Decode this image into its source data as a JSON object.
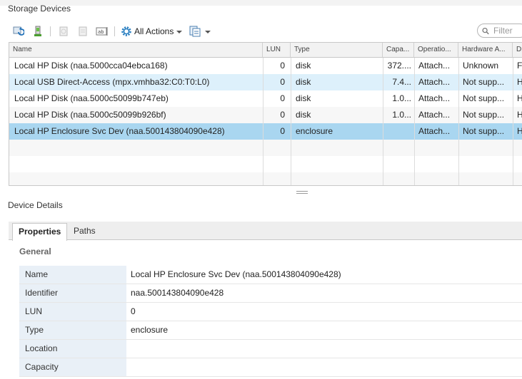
{
  "section": {
    "storage_title": "Storage Devices",
    "details_title": "Device Details"
  },
  "toolbar": {
    "all_actions_label": "All Actions",
    "filter_placeholder": "Filter"
  },
  "grid": {
    "columns": [
      "Name",
      "LUN",
      "Type",
      "Capa...",
      "Operatio...",
      "Hardware A...",
      "Dr"
    ],
    "rows": [
      {
        "name": "Local HP Disk (naa.5000cca04ebca168)",
        "lun": "0",
        "type": "disk",
        "capacity": "372....",
        "operational": "Attach...",
        "hardware": "Unknown",
        "drive": "F"
      },
      {
        "name": "Local USB Direct-Access (mpx.vmhba32:C0:T0:L0)",
        "lun": "0",
        "type": "disk",
        "capacity": "7.4...",
        "operational": "Attach...",
        "hardware": "Not supp...",
        "drive": "H"
      },
      {
        "name": "Local HP Disk (naa.5000c50099b747eb)",
        "lun": "0",
        "type": "disk",
        "capacity": "1.0...",
        "operational": "Attach...",
        "hardware": "Not supp...",
        "drive": "H"
      },
      {
        "name": "Local HP Disk (naa.5000c50099b926bf)",
        "lun": "0",
        "type": "disk",
        "capacity": "1.0...",
        "operational": "Attach...",
        "hardware": "Not supp...",
        "drive": "H"
      },
      {
        "name": "Local HP Enclosure Svc Dev (naa.500143804090e428)",
        "lun": "0",
        "type": "enclosure",
        "capacity": "",
        "operational": "Attach...",
        "hardware": "Not supp...",
        "drive": "H"
      }
    ]
  },
  "details": {
    "tabs": [
      "Properties",
      "Paths"
    ],
    "group_title": "General",
    "properties": [
      {
        "key": "Name",
        "value": "Local HP Enclosure Svc Dev (naa.500143804090e428)"
      },
      {
        "key": "Identifier",
        "value": "naa.500143804090e428"
      },
      {
        "key": "LUN",
        "value": "0"
      },
      {
        "key": "Type",
        "value": "enclosure"
      },
      {
        "key": "Location",
        "value": ""
      },
      {
        "key": "Capacity",
        "value": ""
      }
    ]
  },
  "colors": {
    "selected_row": "#a9d6f0",
    "hover_row": "#ddf0fb",
    "accent": "#2a7fc1"
  }
}
